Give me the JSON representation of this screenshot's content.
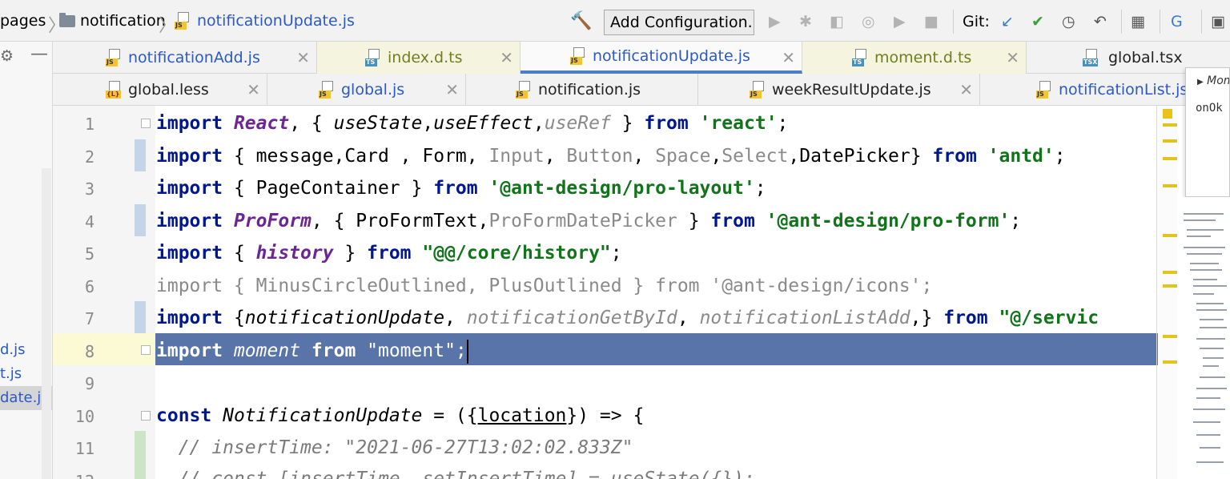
{
  "toolbar": {
    "breadcrumbs": [
      "pages",
      "notification",
      "notificationUpdate.js"
    ],
    "add_configuration": "Add Configuration...",
    "git_label": "Git:"
  },
  "project_panel": {
    "items": [
      "d.js",
      "t.js",
      "date.js"
    ],
    "selected_index": 2
  },
  "tabs_row1": [
    {
      "label": "notificationAdd.js",
      "badge": "JS",
      "color": "blue"
    },
    {
      "label": "index.d.ts",
      "badge": "TS",
      "color": "olive"
    },
    {
      "label": "notificationUpdate.js",
      "badge": "JS",
      "color": "blue",
      "active": true
    },
    {
      "label": "moment.d.ts",
      "badge": "TS",
      "color": "olive"
    },
    {
      "label": "global.tsx",
      "badge": "TSX",
      "color": "plain"
    }
  ],
  "tabs_row2": [
    {
      "label": "global.less",
      "badge": "{L}",
      "color": "plain"
    },
    {
      "label": "global.js",
      "badge": "JS",
      "color": "blue"
    },
    {
      "label": "notification.js",
      "badge": "JS",
      "color": "plain"
    },
    {
      "label": "weekResultUpdate.js",
      "badge": "JS",
      "color": "plain"
    },
    {
      "label": "notificationList.js",
      "badge": "JS",
      "color": "blue"
    }
  ],
  "editor": {
    "line_numbers": [
      "1",
      "2",
      "3",
      "4",
      "5",
      "6",
      "7",
      "8",
      "9",
      "10",
      "11",
      "12"
    ],
    "current_line": 8,
    "lines": {
      "l1": {
        "kw": "import",
        "react": "React",
        "p1": ", { ",
        "use1": "useState",
        "c1": ",",
        "use2": "useEffect",
        "c2": ",",
        "use3": "useRef",
        "p2": " } ",
        "from": "from",
        "str": "'react'",
        "end": ";"
      },
      "l2": {
        "kw": "import",
        "p1": " { message,Card , Form, ",
        "g1": "Input",
        "c1": ", ",
        "g2": "Button",
        "c2": ", ",
        "g3": "Space",
        "c3": ",",
        "g4": "Select",
        "p2": ",DatePicker} ",
        "from": "from",
        "str": "'antd'",
        "end": ";"
      },
      "l3": {
        "kw": "import",
        "p1": " { PageContainer } ",
        "from": "from",
        "str": "'@ant-design/pro-layout'",
        "end": ";"
      },
      "l4": {
        "kw": "import",
        "pf": "ProForm",
        "p1": ", { ProFormText,",
        "g1": "ProFormDatePicker",
        "p2": " } ",
        "from": "from",
        "str": "'@ant-design/pro-form'",
        "end": ";"
      },
      "l5": {
        "kw": "import",
        "p1": " { ",
        "hist": "history",
        "p2": " } ",
        "from": "from",
        "str": "\"@@/core/history\"",
        "end": ";"
      },
      "l6": {
        "text": "import { MinusCircleOutlined, PlusOutlined } from '@ant-design/icons';"
      },
      "l7": {
        "kw": "import",
        "p1": " {",
        "n1": "notificationUpdate",
        "c1": ", ",
        "n2": "notificationGetById",
        "c2": ", ",
        "n3": "notificationListAdd",
        "p2": ",} ",
        "from": "from",
        "str": "\"@/servic"
      },
      "l8": {
        "kw": "import",
        "sp": " ",
        "mom": "moment",
        "sp2": " ",
        "from": "from",
        "str": " \"moment\";"
      },
      "l10": {
        "kw": "const",
        "sp": " ",
        "name": "NotificationUpdate",
        "p1": " = ({",
        "loc": "location",
        "p2": "}) => {"
      },
      "l11": {
        "text": "  // insertTime: \"2021-06-27T13:02:02.833Z\""
      },
      "l12": {
        "text": "  // const [insertTime, setInsertTime] = useState({});"
      }
    }
  },
  "popup": {
    "title": "Mom",
    "item": "onOk"
  }
}
